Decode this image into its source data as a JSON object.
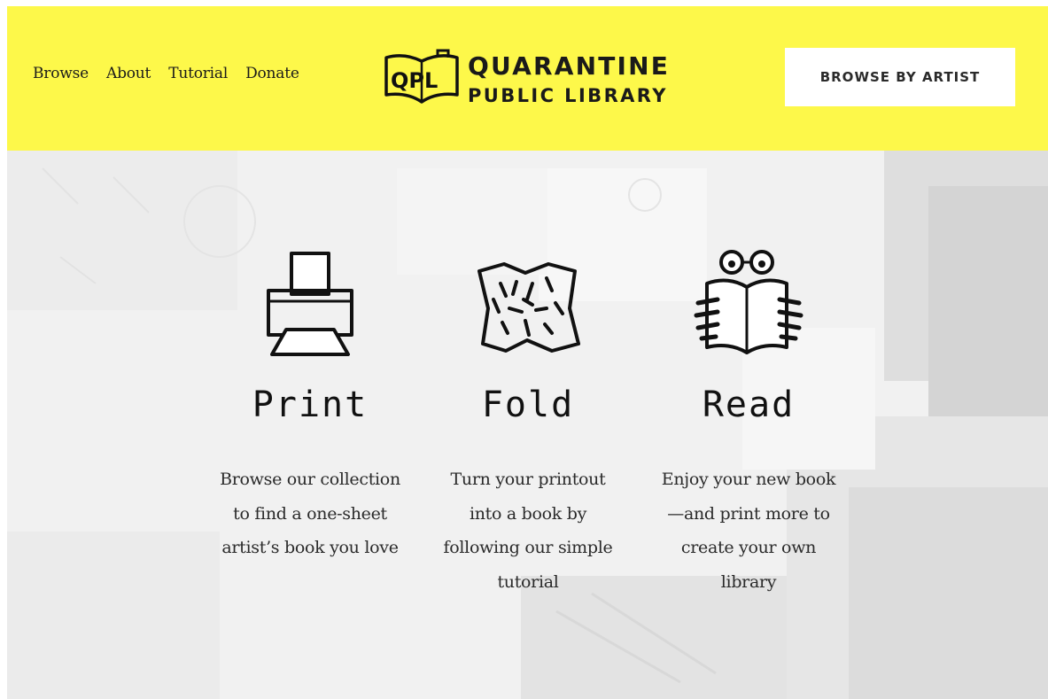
{
  "header": {
    "nav": [
      {
        "label": "Browse"
      },
      {
        "label": "About"
      },
      {
        "label": "Tutorial"
      },
      {
        "label": "Donate"
      }
    ],
    "logo": {
      "mark": "QPL",
      "line1": "QUARANTINE",
      "line2": "PUBLIC LIBRARY"
    },
    "cta_label": "BROWSE BY ARTIST"
  },
  "steps": [
    {
      "icon": "printer-icon",
      "title": "Print",
      "description": "Browse our collection to find a one-sheet artist’s book you love"
    },
    {
      "icon": "folded-map-icon",
      "title": "Fold",
      "description": "Turn your printout into a book by following our simple tutorial"
    },
    {
      "icon": "reading-person-icon",
      "title": "Read",
      "description": "Enjoy your new book—and print more to create your own library"
    }
  ],
  "colors": {
    "header_bg": "#fdf84a",
    "button_bg": "#ffffff",
    "hero_bg": "#f2f2f2",
    "text": "#1a1a1a"
  }
}
